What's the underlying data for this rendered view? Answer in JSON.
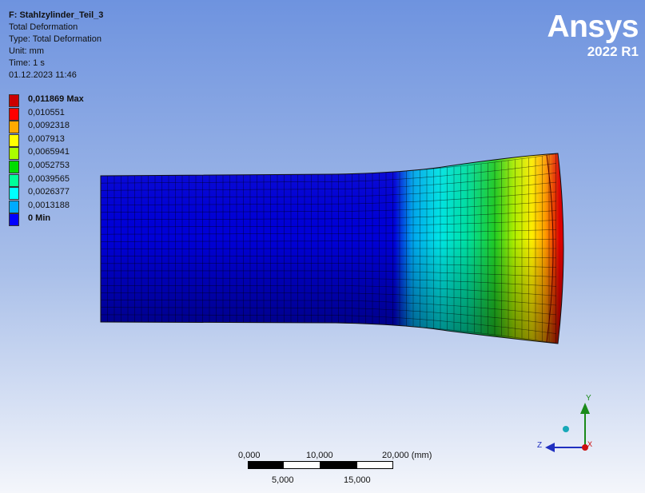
{
  "info": {
    "title": "F: Stahlzylinder_Teil_3",
    "line1": "Total Deformation",
    "line2": "Type: Total Deformation",
    "line3": "Unit: mm",
    "line4": "Time: 1 s",
    "line5": "01.12.2023 11:46"
  },
  "logo": {
    "brand": "Ansys",
    "version": "2022 R1"
  },
  "legend": {
    "items": [
      {
        "label": "0,011869 Max",
        "color": "#cc0000"
      },
      {
        "label": "0,010551",
        "color": "#ff0000"
      },
      {
        "label": "0,0092318",
        "color": "#ffaa00"
      },
      {
        "label": "0,007913",
        "color": "#ffff00"
      },
      {
        "label": "0,0065941",
        "color": "#aaff00"
      },
      {
        "label": "0,0052753",
        "color": "#00dd00"
      },
      {
        "label": "0,0039565",
        "color": "#00ff99"
      },
      {
        "label": "0,0026377",
        "color": "#00ffff"
      },
      {
        "label": "0,0013188",
        "color": "#00aaff"
      },
      {
        "label": "0 Min",
        "color": "#0000ff"
      }
    ]
  },
  "scale": {
    "t0": "0,000",
    "t10": "10,000",
    "t20": "20,000 (mm)",
    "t5": "5,000",
    "t15": "15,000"
  },
  "triad": {
    "y": "Y",
    "z": "Z",
    "x": "X"
  }
}
